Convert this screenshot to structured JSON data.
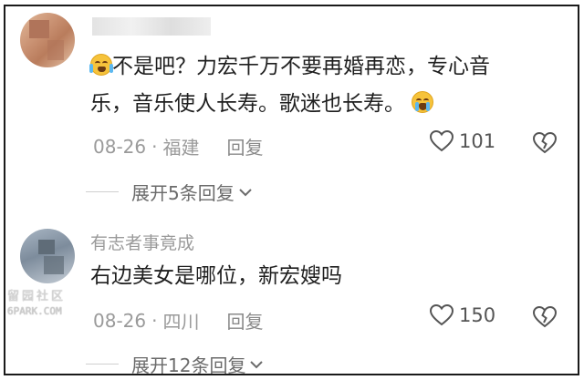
{
  "comments": [
    {
      "username": "",
      "text_line1": "不是吧？力宏千万不要再婚再恋，专心音",
      "text_line2": "乐，音乐使人长寿。歌迷也长寿。",
      "date": "08-26",
      "location": "福建",
      "reply_label": "回复",
      "likes": "101",
      "expand_label": "展开5条回复"
    },
    {
      "username": "有志者事竟成",
      "text_line1": "右边美女是哪位，新宏嫂吗",
      "date": "08-26",
      "location": "四川",
      "reply_label": "回复",
      "likes": "150",
      "expand_label": "展开12条回复"
    }
  ],
  "separator": "·",
  "watermark": {
    "line1": "留园社区",
    "line2": "6PARK.COM"
  },
  "colors": {
    "meta": "#9a9a9a",
    "text": "#1f1f1f",
    "emoji": "#f6c33b"
  }
}
